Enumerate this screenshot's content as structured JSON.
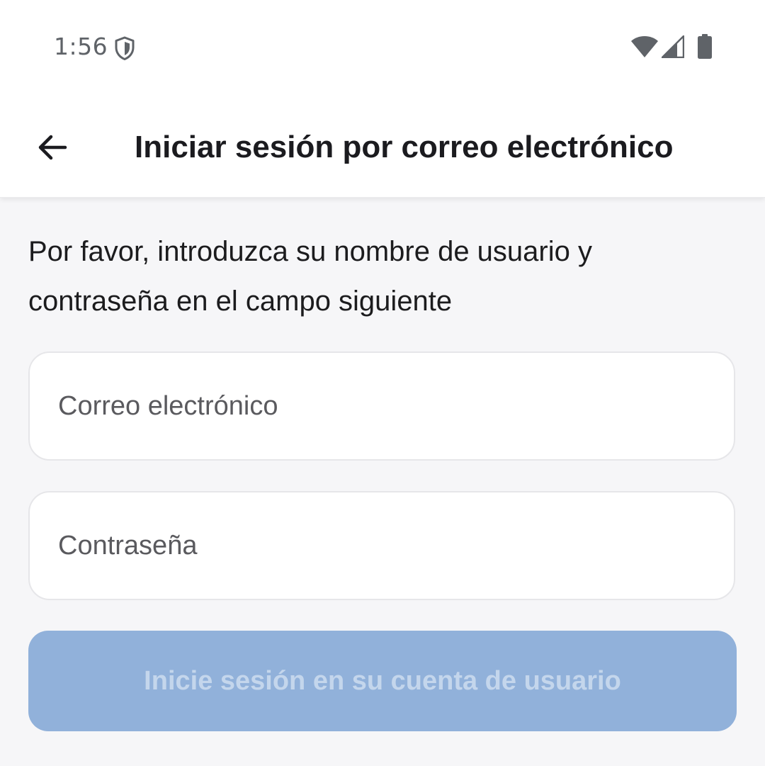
{
  "status_bar": {
    "time": "1:56",
    "icons": [
      "shield-icon",
      "wifi-icon",
      "signal-icon",
      "battery-icon"
    ]
  },
  "app_bar": {
    "back_icon": "arrow-left-icon",
    "title": "Iniciar sesión por correo electrónico"
  },
  "form": {
    "instructions": "Por favor, introduzca su nombre de usuario y contraseña en el campo siguiente",
    "email": {
      "value": "",
      "placeholder": "Correo electrónico"
    },
    "password": {
      "value": "",
      "placeholder": "Contraseña"
    },
    "submit_label": "Inicie sesión en su cuenta de usuario",
    "submit_enabled": false
  },
  "colors": {
    "background": "#f6f6f8",
    "header_background": "#ffffff",
    "button_disabled_bg": "#91b1da",
    "button_disabled_text": "#c4d6ec",
    "title_text": "#1b1b1f",
    "placeholder_text": "#5a5a5e"
  }
}
